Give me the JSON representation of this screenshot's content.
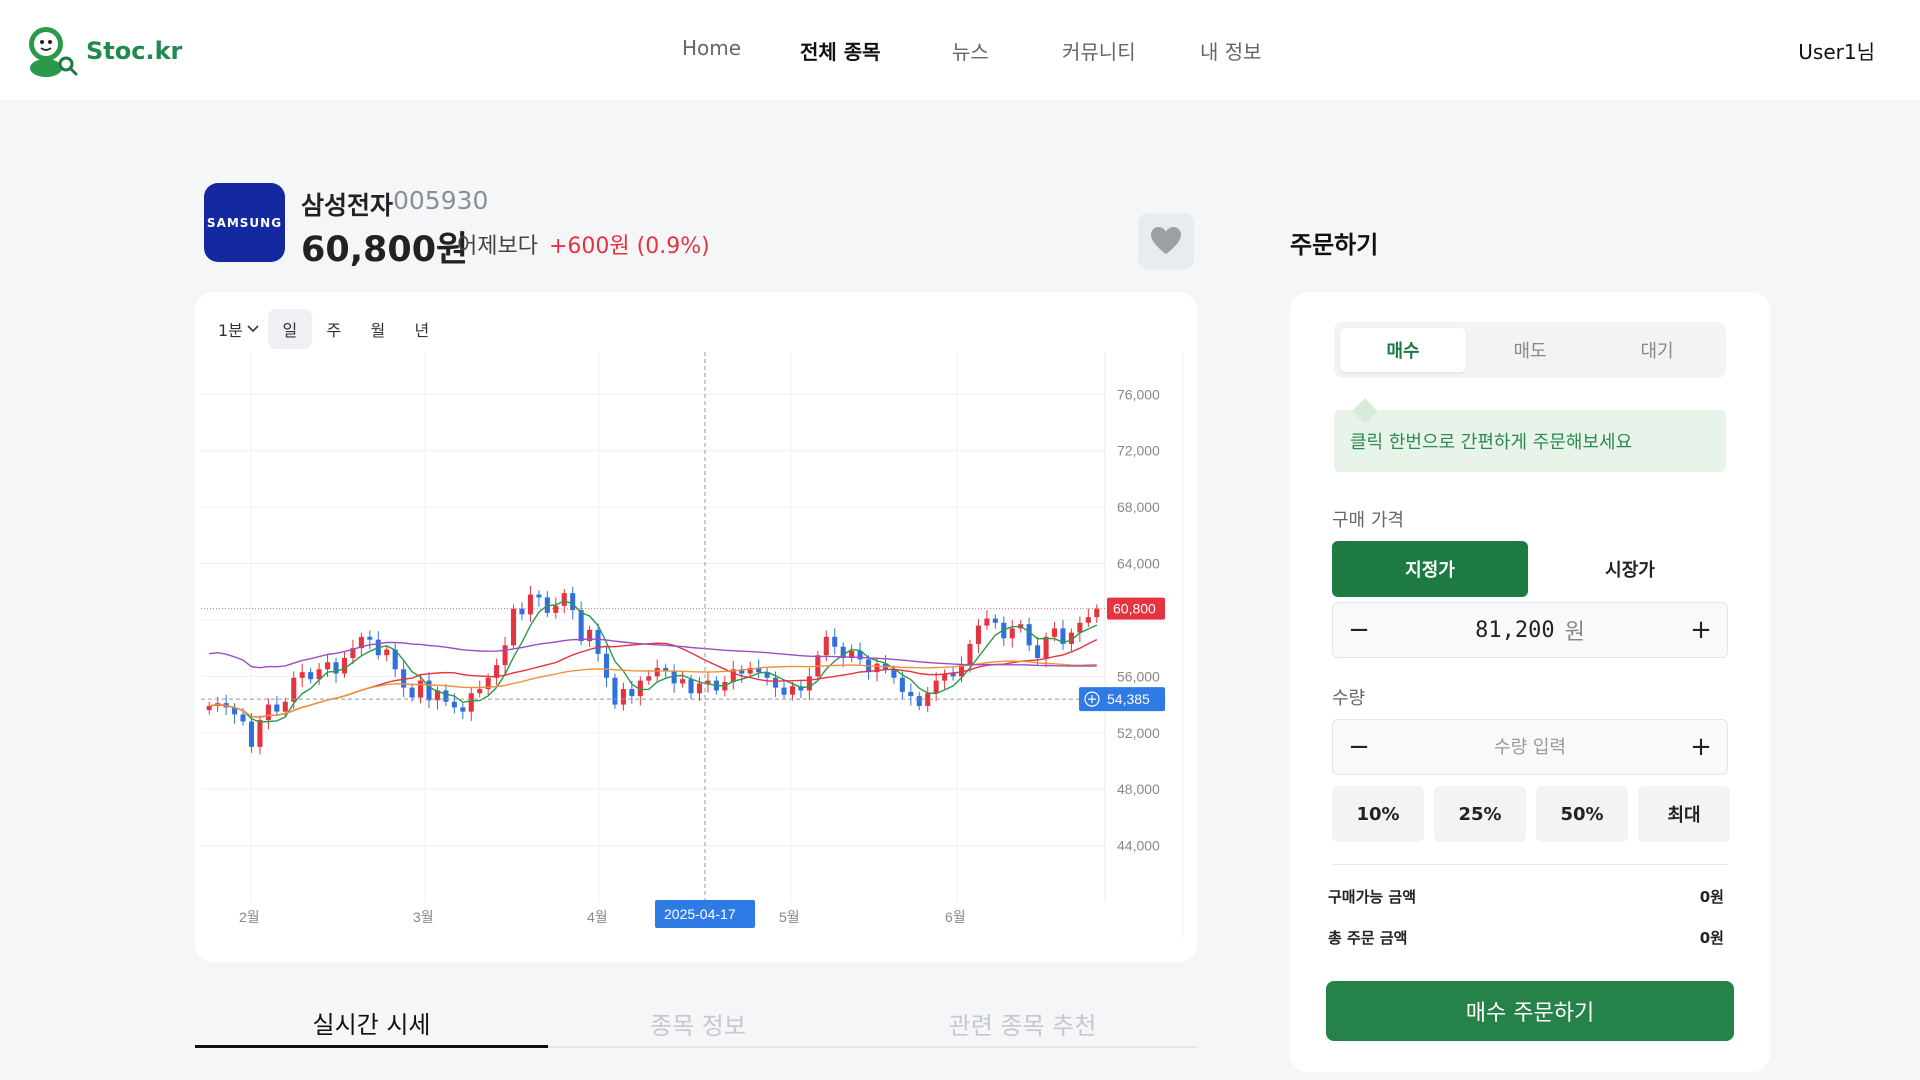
{
  "app": {
    "logo_text": "Stoc.kr"
  },
  "nav": {
    "items": [
      {
        "label": "Home",
        "active": false
      },
      {
        "label": "전체 종목",
        "active": true
      },
      {
        "label": "뉴스",
        "active": false
      },
      {
        "label": "커뮤니티",
        "active": false
      },
      {
        "label": "내 정보",
        "active": false
      }
    ],
    "user_label": "User1님"
  },
  "stock": {
    "logo_text": "SAMSUNG",
    "name": "삼성전자",
    "code": "005930",
    "price": "60,800원",
    "change_label": "어제보다",
    "change_value": "+600원 (0.9%)",
    "change_color": "#e5333f",
    "logo_color": "#1428a0"
  },
  "chart_controls": {
    "interval": "1분",
    "tabs": [
      {
        "label": "일",
        "active": true
      },
      {
        "label": "주",
        "active": false
      },
      {
        "label": "월",
        "active": false
      },
      {
        "label": "년",
        "active": false
      }
    ]
  },
  "chart_data": {
    "type": "candlestick",
    "y_axis_ticks": [
      76000,
      72000,
      68000,
      64000,
      60000,
      56000,
      52000,
      48000,
      44000
    ],
    "y_tick_labels": [
      "76,000",
      "72,000",
      "68,000",
      "64,000",
      "",
      "56,000",
      "52,000",
      "48,000",
      "44,000"
    ],
    "ylim": [
      40000,
      79000
    ],
    "x_axis_labels": [
      "2월",
      "3월",
      "4월",
      "5월",
      "6월"
    ],
    "current_price": 60800,
    "current_price_label": "60,800",
    "crosshair_price": 54385,
    "crosshair_price_label": "54,385",
    "crosshair_date": "2025-04-17",
    "up_color": "#e5333f",
    "down_color": "#2f6fe0",
    "ma_colors": [
      "#2a9a4a",
      "#e5333f",
      "#f0903a",
      "#9b4fc0"
    ],
    "closes": [
      53900,
      54100,
      53800,
      53300,
      52800,
      51000,
      52900,
      54000,
      53500,
      54200,
      55900,
      56300,
      55800,
      56500,
      57000,
      56200,
      57300,
      58000,
      58800,
      58600,
      57500,
      57900,
      56500,
      55200,
      54500,
      55700,
      54300,
      55000,
      54200,
      53800,
      53500,
      54800,
      55100,
      55900,
      56800,
      58200,
      60800,
      60400,
      61800,
      61600,
      60500,
      61000,
      61900,
      60700,
      58500,
      59300,
      57600,
      55900,
      54000,
      55100,
      54600,
      55700,
      56000,
      56600,
      56400,
      55500,
      55800,
      54800,
      55500,
      55700,
      55000,
      55600,
      56500,
      56200,
      56600,
      56300,
      55900,
      55200,
      54700,
      55300,
      55000,
      56000,
      57500,
      58800,
      58100,
      57300,
      57800,
      57200,
      56300,
      56900,
      56500,
      55900,
      54900,
      54600,
      53900,
      54800,
      55700,
      56200,
      56000,
      56800,
      58300,
      59600,
      60100,
      59800,
      58700,
      59400,
      59700,
      58200,
      57300,
      58800,
      59400,
      58300,
      59100,
      59800,
      60200,
      60800
    ]
  },
  "detail_tabs": [
    {
      "label": "실시간 시세",
      "active": true
    },
    {
      "label": "종목 정보",
      "active": false
    },
    {
      "label": "관련 종목 추천",
      "active": false
    }
  ],
  "order": {
    "title": "주문하기",
    "tabs": [
      {
        "label": "매수",
        "active": true
      },
      {
        "label": "매도",
        "active": false
      },
      {
        "label": "대기",
        "active": false
      }
    ],
    "hint": "클릭 한번으로 간편하게 주문해보세요",
    "price_label": "구매 가격",
    "price_types": [
      {
        "label": "지정가",
        "active": true
      },
      {
        "label": "시장가",
        "active": false
      }
    ],
    "price_value": "81,200",
    "price_unit": "원",
    "qty_label": "수량",
    "qty_placeholder": "수량 입력",
    "minus": "−",
    "plus": "+",
    "percent_buttons": [
      "10%",
      "25%",
      "50%",
      "최대"
    ],
    "summary": [
      {
        "label": "구매가능 금액",
        "value": "0원"
      },
      {
        "label": "총 주문 금액",
        "value": "0원"
      }
    ],
    "submit_label": "매수 주문하기",
    "accent_color": "#1e7a43"
  }
}
